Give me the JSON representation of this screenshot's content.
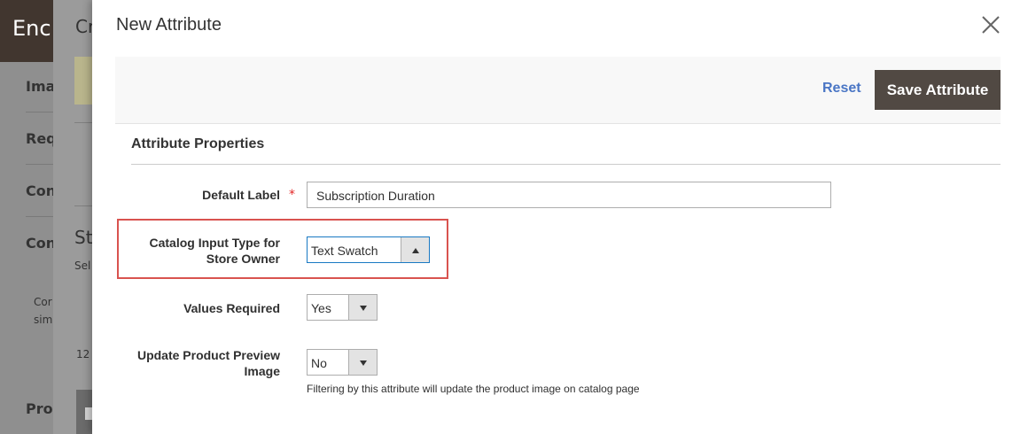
{
  "background": {
    "header_title": "Enc",
    "panel_title": "Cr",
    "nav_items": [
      "Ima",
      "Req",
      "Con",
      "Con",
      "Pro"
    ],
    "small_text_1": "Cor",
    "small_text_2": "sim",
    "section_title": "St",
    "section_sub": "Sel",
    "count_text": "12"
  },
  "modal": {
    "title": "New Attribute",
    "close_icon": "close-icon",
    "actions": {
      "reset_label": "Reset",
      "save_label": "Save Attribute"
    },
    "section_title": "Attribute Properties",
    "fields": {
      "default_label": {
        "label": "Default Label",
        "required_mark": "*",
        "value": "Subscription Duration"
      },
      "input_type": {
        "label_line1": "Catalog Input Type for",
        "label_line2": "Store Owner",
        "value": "Text Swatch",
        "arrow_icon": "chevron-up-icon"
      },
      "values_required": {
        "label": "Values Required",
        "value": "Yes",
        "arrow_icon": "chevron-down-icon"
      },
      "update_preview": {
        "label_line1": "Update Product Preview",
        "label_line2": "Image",
        "value": "No",
        "arrow_icon": "chevron-down-icon",
        "hint": "Filtering by this attribute will update the product image on catalog page"
      }
    }
  },
  "colors": {
    "save_button": "#514943",
    "reset_link": "#4a76c5",
    "highlight": "#d9534f",
    "required": "#e22626"
  }
}
